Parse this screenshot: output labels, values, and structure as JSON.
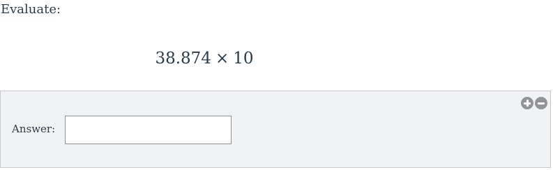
{
  "question": {
    "prompt": "Evaluate:",
    "expression": {
      "left_operand": "38.874",
      "operator": "×",
      "right_operand": "10"
    }
  },
  "answer_panel": {
    "label": "Answer:",
    "input_value": "",
    "input_placeholder": "",
    "controls": {
      "zoom_in_icon": "plus-circle-icon",
      "zoom_out_icon": "minus-circle-icon"
    }
  },
  "colors": {
    "panel_background": "#f1f2f4",
    "panel_border": "#c7c9cc",
    "icon_gray": "#929497",
    "text": "#2b3a47"
  }
}
